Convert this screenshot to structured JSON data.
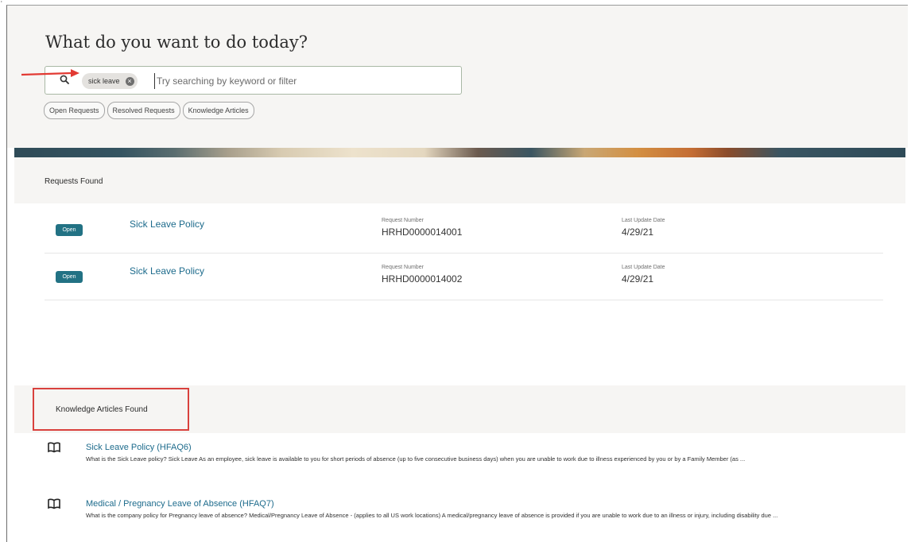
{
  "hero": {
    "title": "What do you want to do today?",
    "search": {
      "chip_label": "sick leave",
      "placeholder": "Try searching by keyword or filter",
      "value": ""
    },
    "filters": [
      "Open Requests",
      "Resolved Requests",
      "Knowledge Articles"
    ]
  },
  "requests": {
    "heading": "Requests Found",
    "items": [
      {
        "status": "Open",
        "title": "Sick Leave Policy",
        "request_number_label": "Request Number",
        "request_number": "HRHD0000014001",
        "last_update_label": "Last Update Date",
        "last_update": "4/29/21"
      },
      {
        "status": "Open",
        "title": "Sick Leave Policy",
        "request_number_label": "Request Number",
        "request_number": "HRHD0000014002",
        "last_update_label": "Last Update Date",
        "last_update": "4/29/21"
      }
    ]
  },
  "knowledge": {
    "heading": "Knowledge Articles Found",
    "items": [
      {
        "title": "Sick Leave Policy (HFAQ6)",
        "description": "What is the Sick Leave policy? Sick Leave As an employee, sick leave is available to you for short periods of absence (up to five consecutive business days) when you are unable to work due to illness experienced by you or by a Family Member (as ..."
      },
      {
        "title": "Medical / Pregnancy Leave of Absence (HFAQ7)",
        "description": "What is the company policy for Pregnancy leave of absence? Medical/Pregnancy Leave of Absence - (applies to all US work locations) A medical/pregnancy leave of absence is provided if you are unable to work due to an illness or injury, including disability due ..."
      }
    ]
  },
  "colors": {
    "accent_link": "#1d6b8c",
    "badge_open": "#227284",
    "highlight_red": "#d9413d",
    "annotation_arrow": "#e23a33"
  },
  "icons": {
    "search": "search-icon",
    "chip_remove": "close-circle-icon",
    "article": "book-icon"
  }
}
